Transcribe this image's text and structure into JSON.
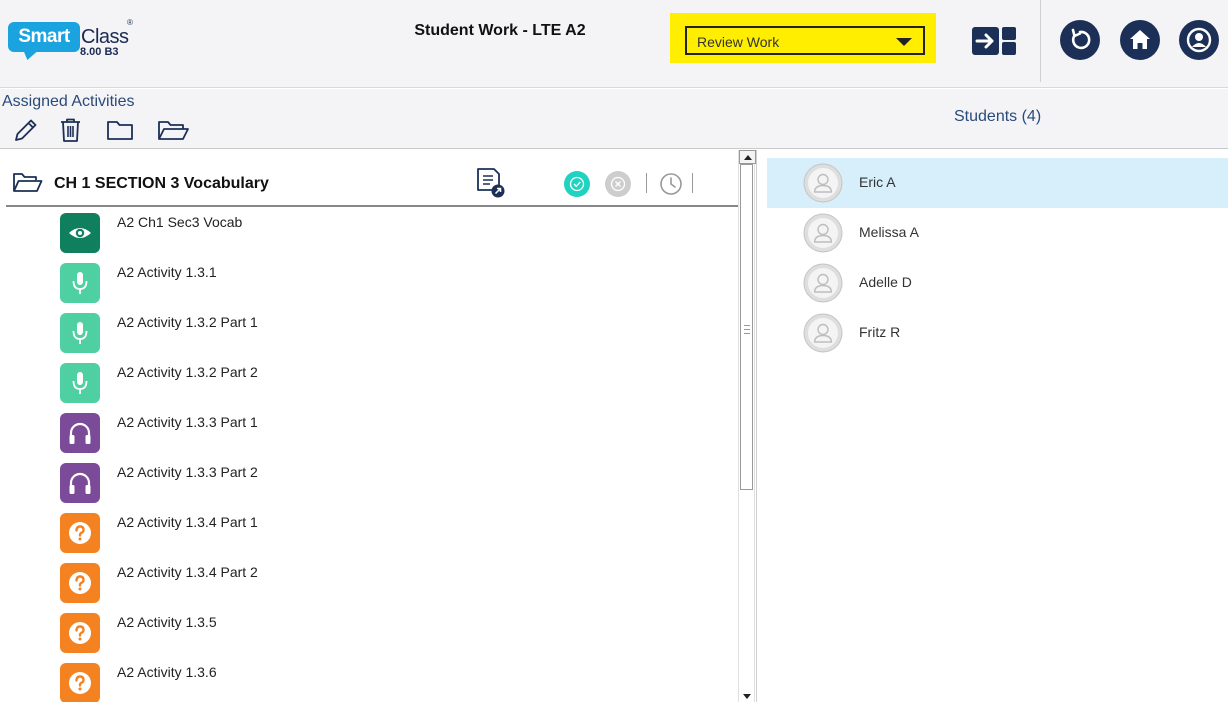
{
  "app": {
    "logo_main": "Smart",
    "logo_class": "Class",
    "logo_reg": "®",
    "version": "8.00 B3"
  },
  "header": {
    "title": "Student Work - LTE A2",
    "dropdown": {
      "selected": "Review Work"
    },
    "highlight_color": "#ffee00",
    "buttons": [
      "switch-view-icon",
      "refresh-icon",
      "home-icon",
      "account-icon"
    ]
  },
  "toolbar": {
    "assigned_label": "Assigned Activities",
    "tools": [
      "edit-icon",
      "delete-icon",
      "folder-icon",
      "open-folder-icon"
    ],
    "students_label": "Students (4)"
  },
  "section": {
    "title": "CH 1 SECTION 3 Vocabulary"
  },
  "activities": [
    {
      "label": "A2 Ch1 Sec3 Vocab",
      "icon": "eye-icon",
      "color": "#0f7f5e"
    },
    {
      "label": "A2 Activity 1.3.1",
      "icon": "microphone-icon",
      "color": "#4fd0a2"
    },
    {
      "label": "A2 Activity 1.3.2 Part 1",
      "icon": "microphone-icon",
      "color": "#4fd0a2"
    },
    {
      "label": "A2 Activity 1.3.2 Part 2",
      "icon": "microphone-icon",
      "color": "#4fd0a2"
    },
    {
      "label": "A2 Activity 1.3.3 Part 1",
      "icon": "headphones-icon",
      "color": "#7b4a99"
    },
    {
      "label": "A2 Activity 1.3.3 Part 2",
      "icon": "headphones-icon",
      "color": "#7b4a99"
    },
    {
      "label": "A2 Activity 1.3.4 Part 1",
      "icon": "question-icon",
      "color": "#f58220"
    },
    {
      "label": "A2 Activity 1.3.4 Part 2",
      "icon": "question-icon",
      "color": "#f58220"
    },
    {
      "label": "A2 Activity 1.3.5",
      "icon": "question-icon",
      "color": "#f58220"
    },
    {
      "label": "A2 Activity 1.3.6",
      "icon": "question-icon",
      "color": "#f58220"
    }
  ],
  "students": [
    {
      "name": "Eric A",
      "selected": true
    },
    {
      "name": "Melissa A",
      "selected": false
    },
    {
      "name": "Adelle D",
      "selected": false
    },
    {
      "name": "Fritz R",
      "selected": false
    }
  ],
  "colors": {
    "navy": "#1c3057",
    "selected_row": "#d7effa",
    "accent_blue": "#1ba3e0",
    "teal_check": "#1fd3c0"
  }
}
